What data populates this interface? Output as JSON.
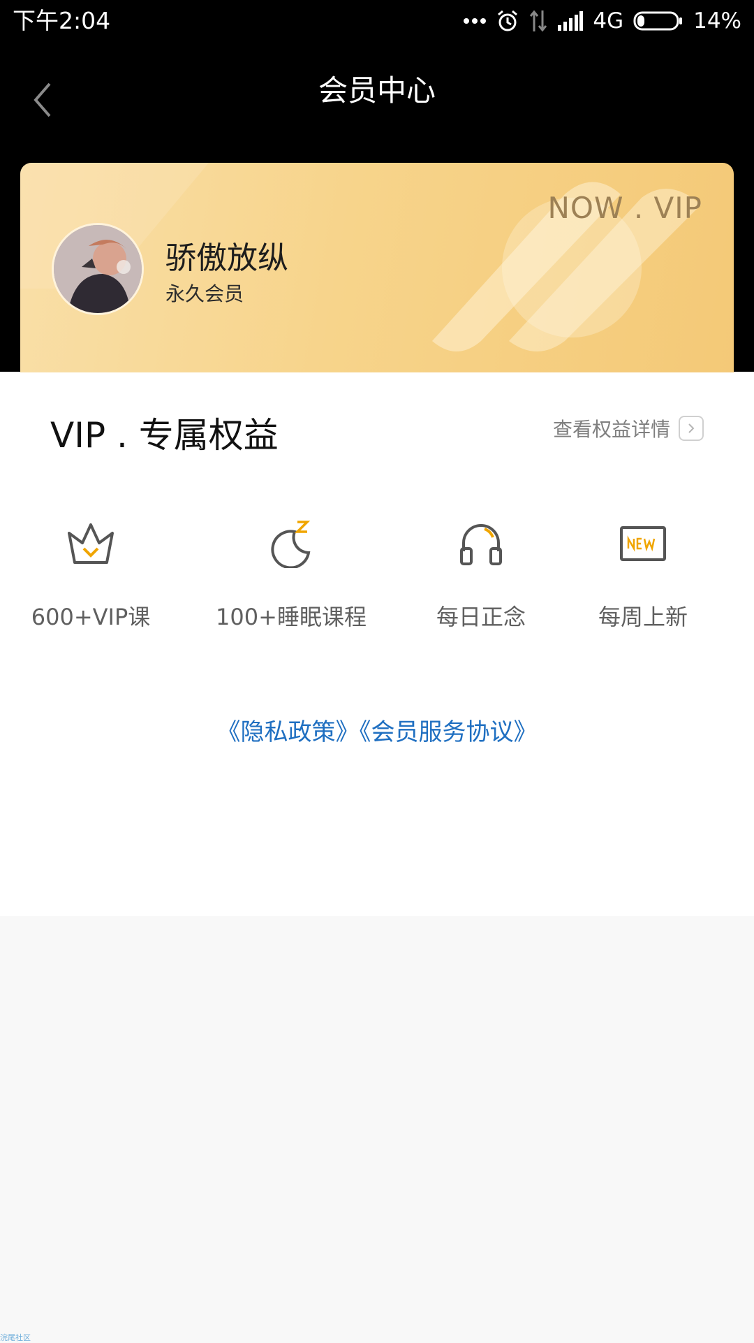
{
  "status_bar": {
    "time": "下午2:04",
    "network": "4G",
    "battery": "14%"
  },
  "header": {
    "title": "会员中心"
  },
  "vip_card": {
    "tag": "NOW . VIP",
    "user_name": "骄傲放纵",
    "member_type": "永久会员"
  },
  "benefits": {
    "title": "VIP . 专属权益",
    "detail_link": "查看权益详情",
    "items": [
      {
        "label": "600+VIP课",
        "icon": "crown-icon"
      },
      {
        "label": "100+睡眠课程",
        "icon": "moon-sleep-icon"
      },
      {
        "label": "每日正念",
        "icon": "headphones-icon"
      },
      {
        "label": "每周上新",
        "icon": "new-badge-icon"
      }
    ]
  },
  "agreements": {
    "privacy": "《隐私政策》",
    "membership": "《会员服务协议》"
  },
  "watermark": "浣尾社区",
  "colors": {
    "accent": "#f6c96f",
    "link": "#1f6fc1",
    "icon_highlight": "#f0a500"
  }
}
